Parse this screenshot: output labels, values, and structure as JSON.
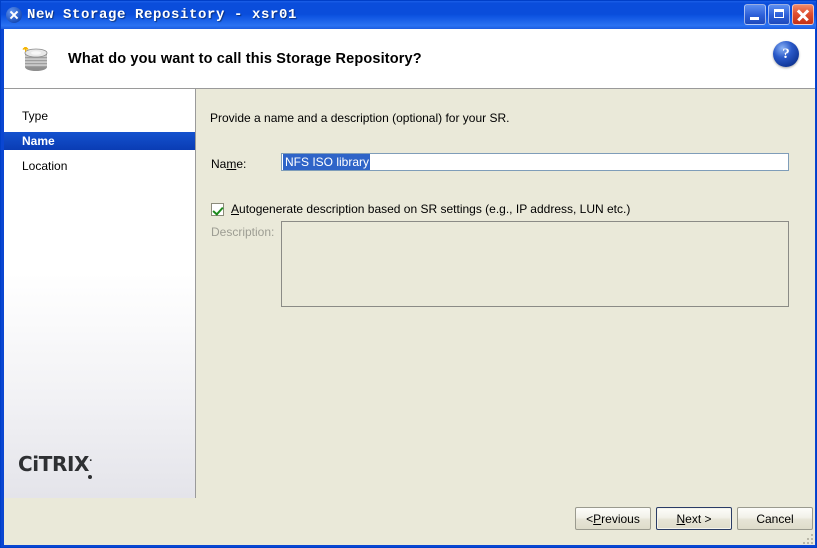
{
  "window": {
    "title": "New Storage Repository - xsr01",
    "icon": "app-x-icon",
    "controls": {
      "minimize": "minimize-button",
      "maximize": "maximize-button",
      "close": "close-button"
    }
  },
  "header": {
    "icon": "storage-repository-cylinder-icon",
    "title": "What do you want to call this Storage Repository?",
    "help_label": "?"
  },
  "sidebar": {
    "items": [
      {
        "label": "Type",
        "active": false
      },
      {
        "label": "Name",
        "active": true
      },
      {
        "label": "Location",
        "active": false
      }
    ],
    "logo": {
      "pre": "C",
      "part1": "iTR",
      "part2": "I",
      "part3": "X",
      "full": "CiTRIX",
      "registered": "·"
    }
  },
  "content": {
    "intro": "Provide a name and a description (optional) for your SR.",
    "name": {
      "label_pre": "Na",
      "label_mn": "m",
      "label_post": "e:",
      "label_full": "Name:",
      "value": "NFS ISO library",
      "selected": true
    },
    "autogenerate": {
      "checked": true,
      "label_mn": "A",
      "label_post": "utogenerate description based on SR settings (e.g., IP address, LUN etc.)",
      "label_full": "Autogenerate description based on SR settings (e.g., IP address, LUN etc.)"
    },
    "description": {
      "label": "Description:",
      "value": "",
      "disabled": true
    }
  },
  "footer": {
    "previous": {
      "pre": "< ",
      "mn": "P",
      "post": "revious",
      "full": "< Previous"
    },
    "next": {
      "pre": "",
      "mn": "N",
      "post": "ext >",
      "full": "Next >",
      "is_default": true
    },
    "cancel": {
      "full": "Cancel"
    }
  },
  "colors": {
    "titlebar_blue": "#0a4ddb",
    "window_border": "#0a46d2",
    "panel_beige": "#eae9d9",
    "nav_active": "#0a3fbe",
    "selection_blue": "#2f64c8",
    "check_green": "#1d8a1d",
    "disabled_text": "#9d9d93"
  }
}
